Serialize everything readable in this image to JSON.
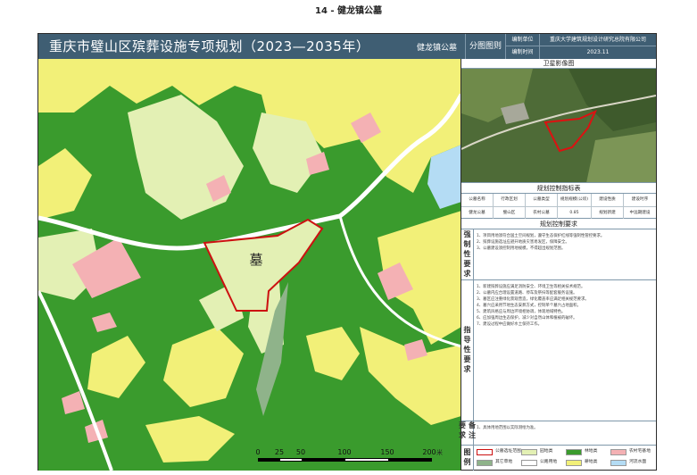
{
  "page": {
    "title": "14 - 健龙镇公墓"
  },
  "header": {
    "title": "重庆市璧山区殡葬设施专项规划（2023—2035年）",
    "town": "健龙镇公墓",
    "figure": "分图图则",
    "meta": [
      {
        "label": "编制单位",
        "value": "重庆大学建筑规划设计研究总院有限公司"
      },
      {
        "label": "编制时间",
        "value": "2023.11"
      }
    ]
  },
  "map": {
    "site_label": "墓",
    "scale": {
      "ticks": [
        "0",
        "25",
        "50",
        "100",
        "150",
        "200"
      ],
      "unit": "米"
    },
    "colors": {
      "forest": "#3a9b2d",
      "farmland": "#f2f078",
      "garden": "#e3f0b4",
      "village": "#f4b1b4",
      "water": "#b4dcf4",
      "road": "#ffffff",
      "boundary": "#cc1111"
    }
  },
  "panel": {
    "satellite_title": "卫星影像图",
    "control_title": "规划控制指标表",
    "control_headers": [
      "公墓名称",
      "行政区划",
      "公墓类型",
      "规划规模(公顷)",
      "建设性质",
      "建设时序"
    ],
    "control_values": [
      "健龙公墓",
      "璧山区",
      "农村公墓",
      "0.85",
      "规划新建",
      "中远期建设"
    ],
    "requirements_title": "规划控制要求",
    "sections": [
      {
        "side": "强制性要求",
        "lines": [
          "1、项目用地须符合国土空间规划，遵守生态保护红线等强制性管控要求。",
          "2、殡葬设施选址应避开地质灾害易发区，保障安全。",
          "3、公墓建设须控制用地规模，不得超出规划范围。"
        ]
      },
      {
        "side": "指导性要求",
        "lines": [
          "1、新建殡葬设施应满足消防安全、环境卫生等相关技术规范。",
          "2、公墓内应合理设置道路、停车及祭扫等配套服务设施。",
          "3、墓区应注重绿化景观营造，绿化覆盖率应满足相关规范要求。",
          "4、墓穴应采用节地生态安葬方式，控制单个墓穴占地面积。",
          "5、建筑风格应与周边环境相协调，体现地域特色。",
          "6、应加强周边生态保护，减少对自然山体和植被的破坏。",
          "7、建设过程中应做好水土保持工作。"
        ]
      },
      {
        "side": "备注要求",
        "lines": [
          "1、具体用地范围以实际测绘为准。"
        ]
      }
    ],
    "legend_label": "图例",
    "legend": [
      {
        "label": "公墓选址范围",
        "color": "#ffffff",
        "border": "#cc1111"
      },
      {
        "label": "园地类",
        "color": "#e3f0b4",
        "border": "#999999"
      },
      {
        "label": "林地类",
        "color": "#3a9b2d",
        "border": "#999999"
      },
      {
        "label": "农村宅基地",
        "color": "#f4b1b4",
        "border": "#999999"
      },
      {
        "label": "其它草地",
        "color": "#8fb38a",
        "border": "#999999"
      },
      {
        "label": "公路用地",
        "color": "#ffffff",
        "border": "#999999"
      },
      {
        "label": "耕地类",
        "color": "#f2f078",
        "border": "#999999"
      },
      {
        "label": "河流水面",
        "color": "#b4dcf4",
        "border": "#999999"
      }
    ]
  }
}
